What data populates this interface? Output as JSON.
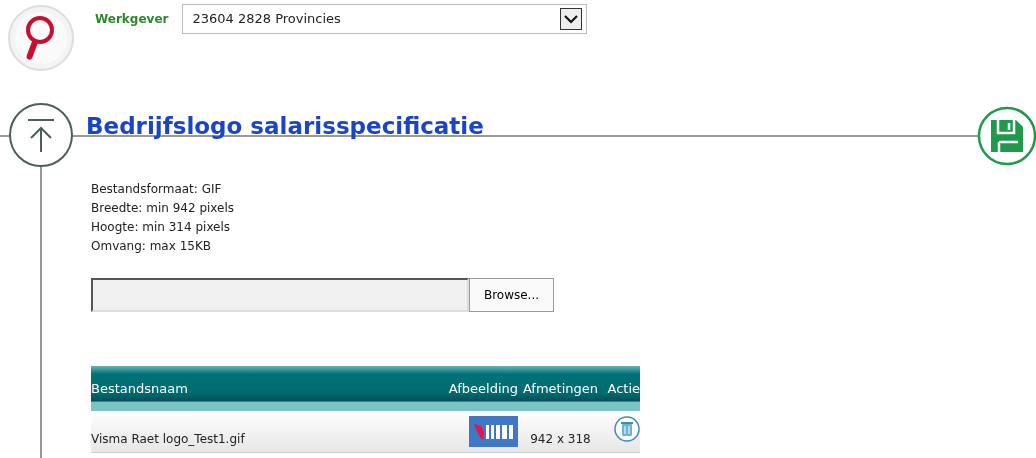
{
  "employer": {
    "label": "Werkgever",
    "value": "23604 2828 Provincies"
  },
  "section": {
    "title": "Bedrijfslogo salarisspecificatie"
  },
  "requirements": [
    "Bestandsformaat: GIF",
    "Breedte: min 942 pixels",
    "Hoogte: min 314 pixels",
    "Omvang: max 15KB"
  ],
  "upload": {
    "button": "Browse..."
  },
  "table": {
    "columns": [
      "Bestandsnaam",
      "Afbeelding",
      "Afmetingen",
      "Actie"
    ],
    "rows": [
      {
        "file": "Visma Raet logo_Test1.gif",
        "size": "942 x 318"
      }
    ]
  }
}
